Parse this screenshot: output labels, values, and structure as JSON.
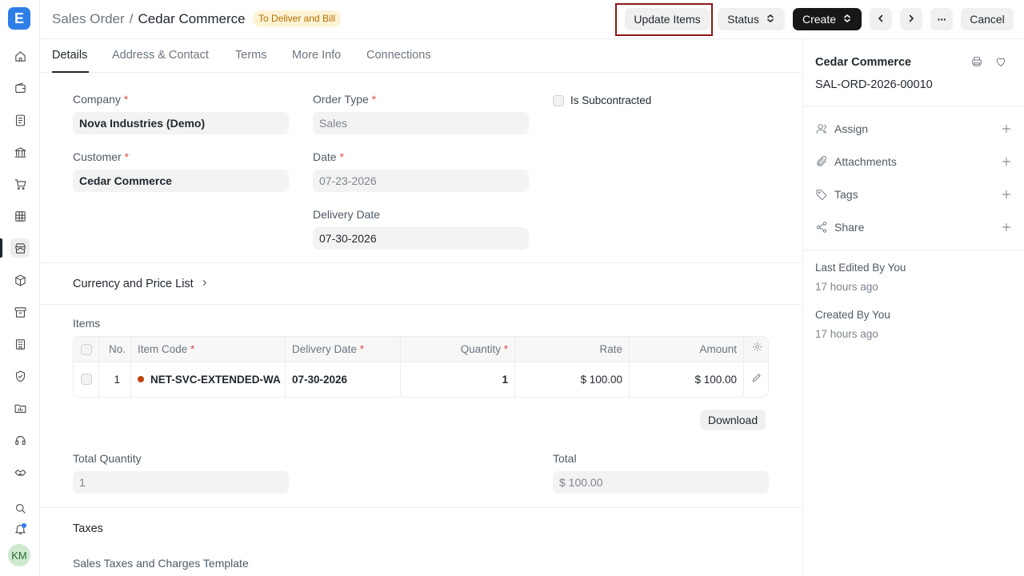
{
  "app": {
    "logo_letter": "E",
    "user_initials": "KM"
  },
  "rail": [
    "home-icon",
    "wallet-icon",
    "document-icon",
    "bank-icon",
    "cart-icon",
    "grid-icon",
    "store-icon",
    "package-icon",
    "archive-icon",
    "building-icon",
    "shield-icon",
    "folder-chart-icon",
    "headset-icon",
    "handshake-icon",
    "search-icon",
    "bell-icon"
  ],
  "header": {
    "breadcrumb_parent": "Sales Order",
    "breadcrumb_sep": "/",
    "title": "Cedar Commerce",
    "status": "To Deliver and Bill",
    "update_items": "Update Items",
    "status_btn": "Status",
    "create_btn": "Create",
    "more": "···",
    "cancel": "Cancel"
  },
  "tabs": [
    "Details",
    "Address & Contact",
    "Terms",
    "More Info",
    "Connections"
  ],
  "form": {
    "company_label": "Company",
    "company": "Nova Industries (Demo)",
    "order_type_label": "Order Type",
    "order_type": "Sales",
    "is_subcontracted_label": "Is Subcontracted",
    "customer_label": "Customer",
    "customer": "Cedar Commerce",
    "date_label": "Date",
    "date": "07-23-2026",
    "delivery_date_label": "Delivery Date",
    "delivery_date": "07-30-2026",
    "required_mark": "*",
    "currency_section": "Currency and Price List",
    "items_label": "Items",
    "download": "Download",
    "total_qty_label": "Total Quantity",
    "total_qty": "1",
    "total_label": "Total",
    "total": "$ 100.00",
    "taxes_section": "Taxes",
    "taxes_template_label": "Sales Taxes and Charges Template"
  },
  "items_table": {
    "headers": {
      "no": "No.",
      "item_code": "Item Code",
      "delivery_date": "Delivery Date",
      "quantity": "Quantity",
      "rate": "Rate",
      "amount": "Amount"
    },
    "rows": [
      {
        "no": "1",
        "item_code": "NET-SVC-EXTENDED-WA",
        "delivery_date": "07-30-2026",
        "quantity": "1",
        "rate": "$ 100.00",
        "amount": "$ 100.00"
      }
    ]
  },
  "sidebar": {
    "title": "Cedar Commerce",
    "doc_id": "SAL-ORD-2026-00010",
    "assign": "Assign",
    "attachments": "Attachments",
    "tags": "Tags",
    "share": "Share",
    "last_edited": "Last Edited By You",
    "last_edited_time": "17 hours ago",
    "created": "Created By You",
    "created_time": "17 hours ago"
  }
}
